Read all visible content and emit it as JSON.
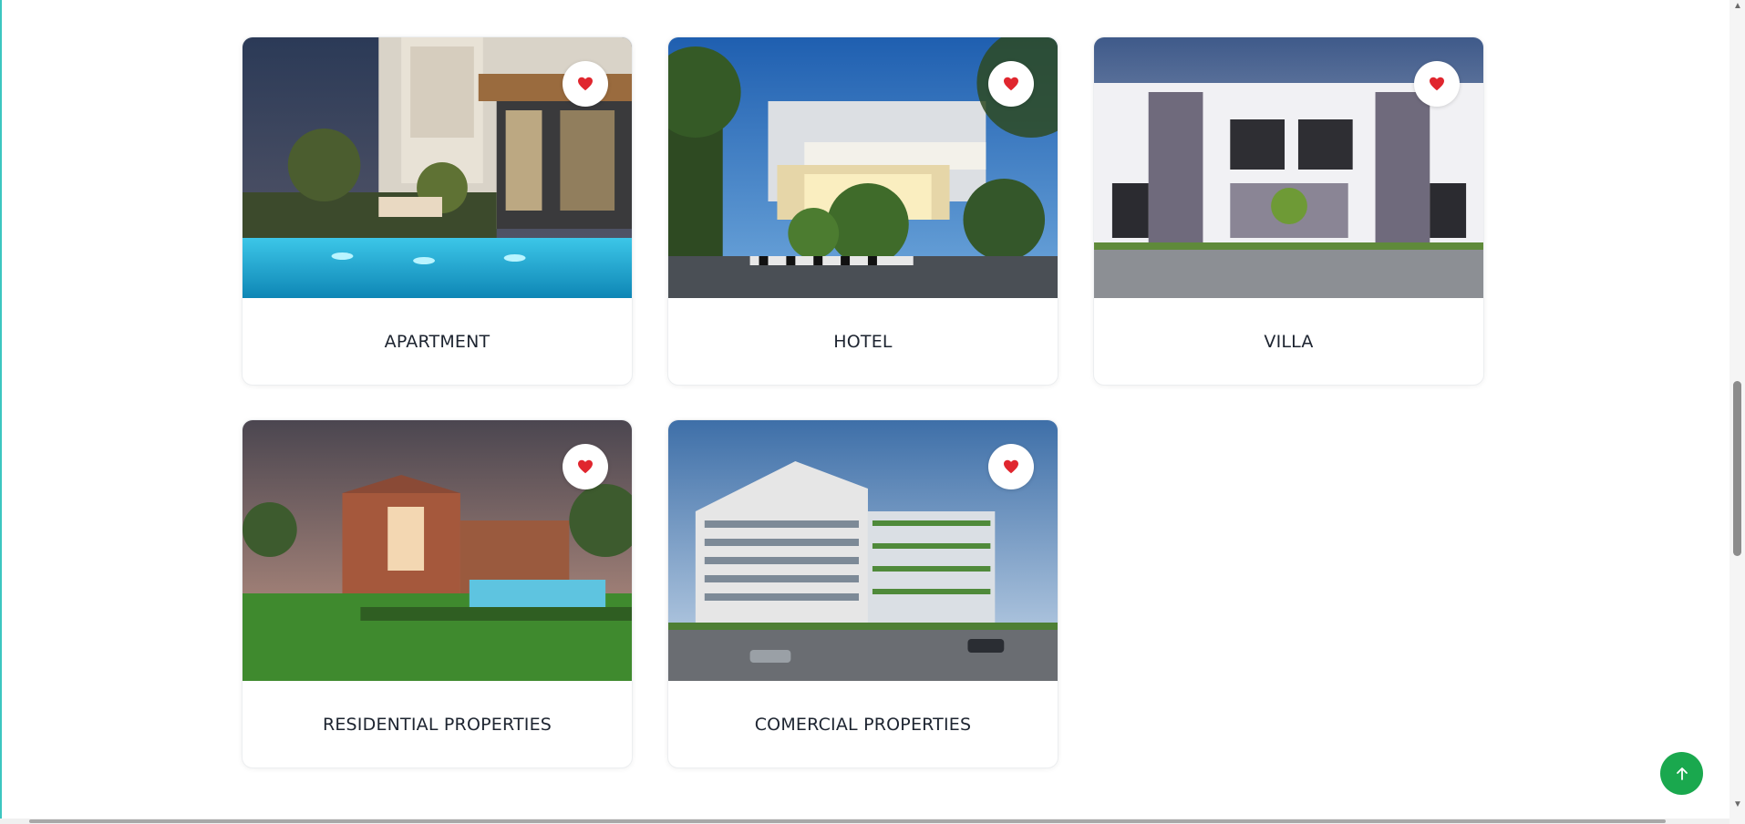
{
  "cards": [
    {
      "title": "APARTMENT",
      "image": "apartment-photo",
      "favorite_icon": "heart-icon"
    },
    {
      "title": "HOTEL",
      "image": "hotel-photo",
      "favorite_icon": "heart-icon"
    },
    {
      "title": "VILLA",
      "image": "villa-photo",
      "favorite_icon": "heart-icon"
    },
    {
      "title": "RESIDENTIAL PROPERTIES",
      "image": "residential-photo",
      "favorite_icon": "heart-icon"
    },
    {
      "title": "COMERCIAL PROPERTIES",
      "image": "commercial-photo",
      "favorite_icon": "heart-icon"
    }
  ],
  "scroll_top_button": {
    "icon": "arrow-up-icon"
  },
  "colors": {
    "heart": "#e0262e",
    "scroll_top_bg": "#1aa84e",
    "title_text": "#1d2430",
    "card_border": "#eceef0"
  }
}
